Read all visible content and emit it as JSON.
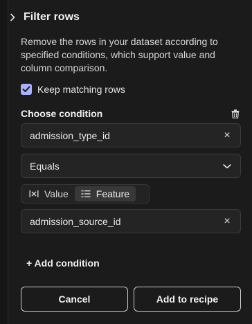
{
  "panel": {
    "title": "Filter rows",
    "description": "Remove the rows in your dataset according to specified conditions, which support value and column comparison.",
    "keep_matching": {
      "label": "Keep matching rows",
      "checked": true
    }
  },
  "condition": {
    "heading": "Choose condition",
    "column_value": "admission_type_id",
    "operator_value": "Equals",
    "mode_options": [
      {
        "label": "Value",
        "icon": "value-icon",
        "selected": false
      },
      {
        "label": "Feature",
        "icon": "list-icon",
        "selected": true
      }
    ],
    "compare_value": "admission_source_id",
    "clear_glyph": "×"
  },
  "add_condition_label": "+ Add condition",
  "footer": {
    "cancel_label": "Cancel",
    "submit_label": "Add to recipe"
  },
  "colors": {
    "background": "#1b1b1b",
    "checkbox_accent": "#a9b0ff",
    "field_bg": "#242424"
  }
}
